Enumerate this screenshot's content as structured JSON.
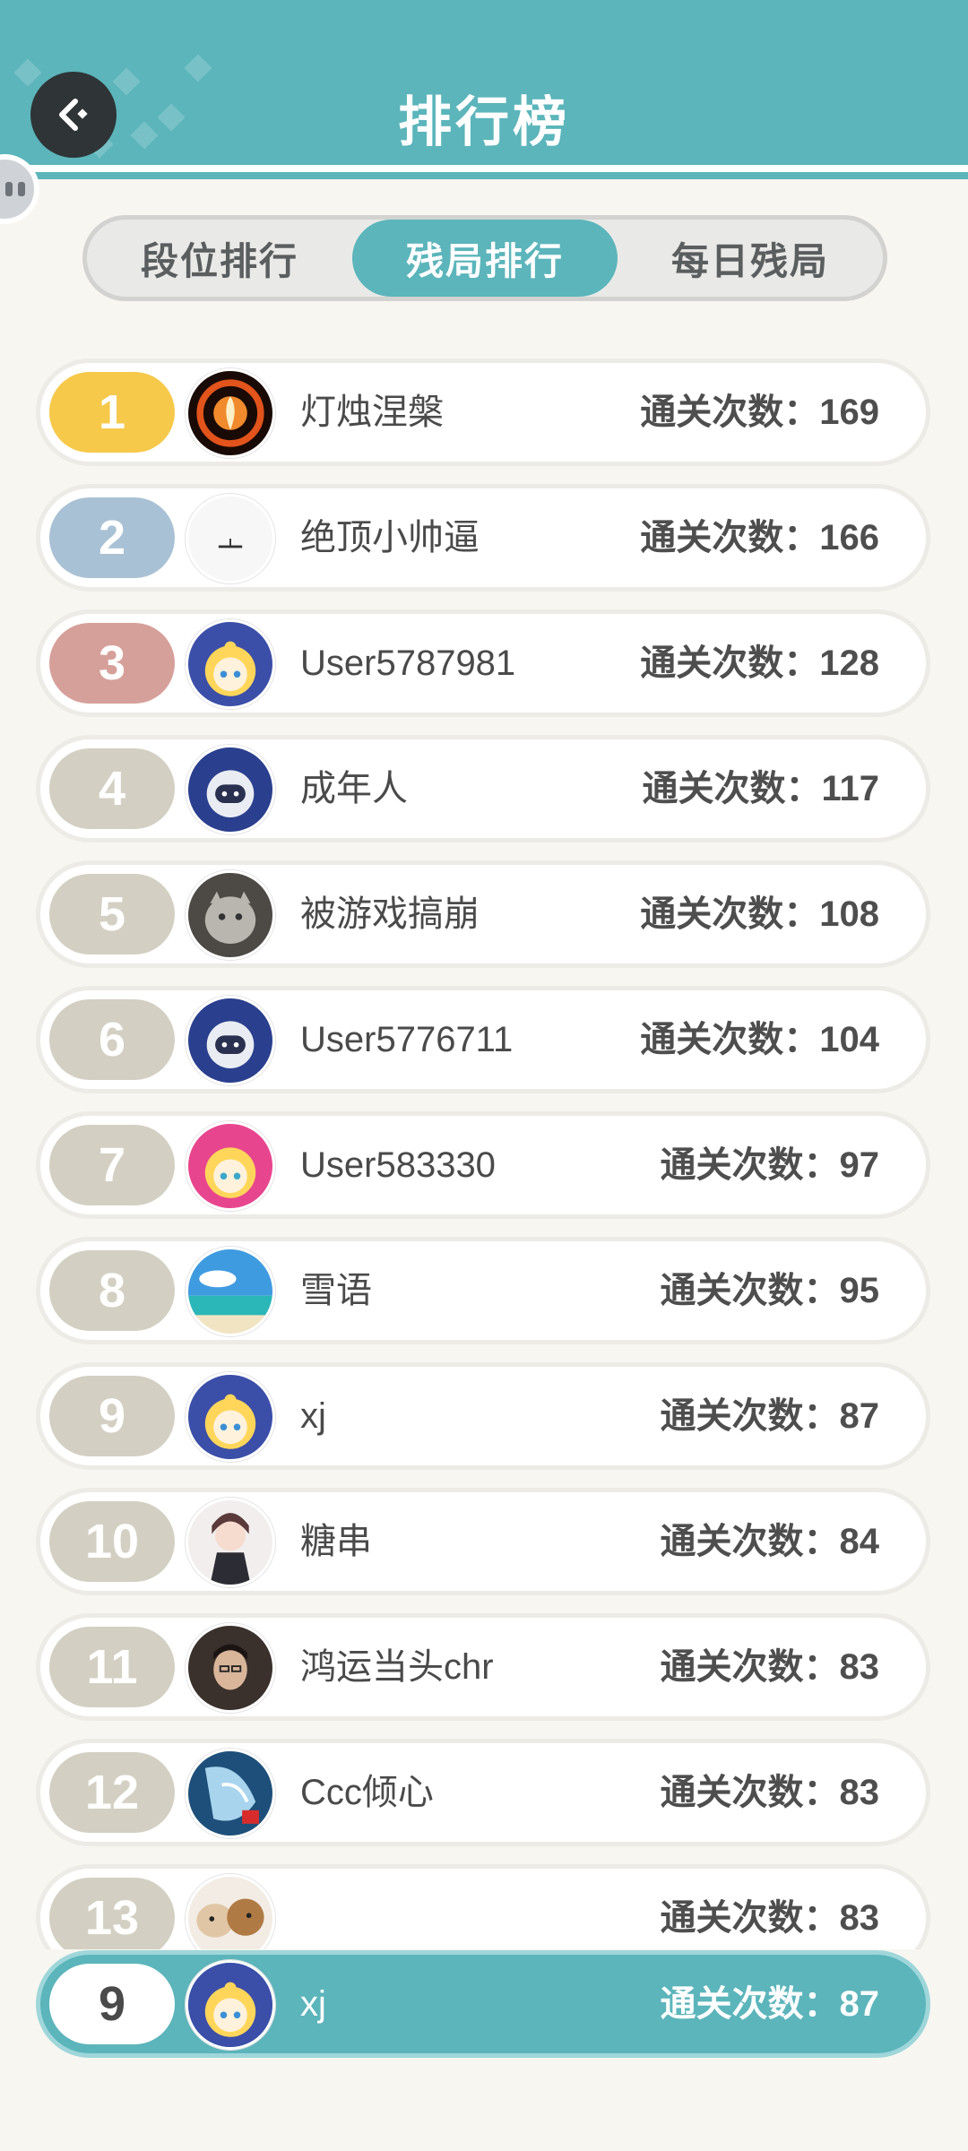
{
  "header": {
    "title": "排行榜",
    "back_icon": "back-arrow-icon",
    "accent": "#5bb5bb"
  },
  "tabs": [
    {
      "label": "段位排行",
      "active": false
    },
    {
      "label": "残局排行",
      "active": true
    },
    {
      "label": "每日残局",
      "active": false
    }
  ],
  "ranking": [
    {
      "rank": "1",
      "name": "灯烛涅槃",
      "score": "通关次数：169",
      "avatar": "phoenix-avatar-icon"
    },
    {
      "rank": "2",
      "name": "绝顶小帅逼",
      "score": "通关次数：166",
      "avatar": "boat-avatar-icon"
    },
    {
      "rank": "3",
      "name": "User5787981",
      "score": "通关次数：128",
      "avatar": "cartoon-girl-avatar-icon"
    },
    {
      "rank": "4",
      "name": "成年人",
      "score": "通关次数：117",
      "avatar": "robot-avatar-icon"
    },
    {
      "rank": "5",
      "name": "被游戏搞崩",
      "score": "通关次数：108",
      "avatar": "cat-avatar-icon"
    },
    {
      "rank": "6",
      "name": "User5776711",
      "score": "通关次数：104",
      "avatar": "robot-avatar-icon"
    },
    {
      "rank": "7",
      "name": "User583330",
      "score": "通关次数：97",
      "avatar": "cartoon-girl-pink-avatar-icon"
    },
    {
      "rank": "8",
      "name": "雪语",
      "score": "通关次数：95",
      "avatar": "beach-avatar-icon"
    },
    {
      "rank": "9",
      "name": "xj",
      "score": "通关次数：87",
      "avatar": "cartoon-girl-avatar-icon"
    },
    {
      "rank": "10",
      "name": "糖串",
      "score": "通关次数：84",
      "avatar": "anime-girl-avatar-icon"
    },
    {
      "rank": "11",
      "name": "鸿运当头chr",
      "score": "通关次数：83",
      "avatar": "photo-avatar-icon"
    },
    {
      "rank": "12",
      "name": "Ccc倾心",
      "score": "通关次数：83",
      "avatar": "wolf-avatar-icon"
    },
    {
      "rank": "13",
      "name": "",
      "score": "通关次数：83",
      "avatar": "dogs-avatar-icon"
    }
  ],
  "my_rank": {
    "rank": "9",
    "name": "xj",
    "score": "通关次数：87",
    "avatar": "cartoon-girl-avatar-icon"
  }
}
